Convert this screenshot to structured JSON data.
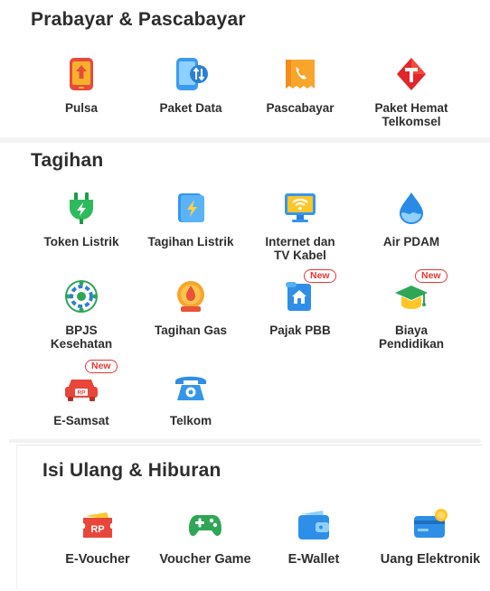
{
  "sections": [
    {
      "title": "Prabayar & Pascabayar",
      "items": [
        {
          "label": "Pulsa",
          "icon": "phone-upload-icon"
        },
        {
          "label": "Paket Data",
          "icon": "phone-data-icon"
        },
        {
          "label": "Pascabayar",
          "icon": "bill-phone-icon"
        },
        {
          "label": "Paket Hemat Telkomsel",
          "icon": "telkomsel-logo-icon"
        }
      ]
    },
    {
      "title": "Tagihan",
      "items": [
        {
          "label": "Token Listrik",
          "icon": "plug-icon"
        },
        {
          "label": "Tagihan Listrik",
          "icon": "electric-bill-icon"
        },
        {
          "label": "Internet dan TV Kabel",
          "icon": "wifi-tv-icon"
        },
        {
          "label": "Air PDAM",
          "icon": "water-drop-icon"
        },
        {
          "label": "BPJS Kesehatan",
          "icon": "bpjs-icon"
        },
        {
          "label": "Tagihan Gas",
          "icon": "gas-icon"
        },
        {
          "label": "Pajak PBB",
          "icon": "property-tax-icon",
          "badge": "New"
        },
        {
          "label": "Biaya Pendidikan",
          "icon": "graduation-cap-icon",
          "badge": "New"
        },
        {
          "label": "E-Samsat",
          "icon": "car-tax-icon",
          "badge": "New"
        },
        {
          "label": "Telkom",
          "icon": "telephone-icon"
        }
      ]
    },
    {
      "title": "Isi Ulang & Hiburan",
      "items": [
        {
          "label": "E-Voucher",
          "icon": "voucher-icon"
        },
        {
          "label": "Voucher Game",
          "icon": "gamepad-icon"
        },
        {
          "label": "E-Wallet",
          "icon": "wallet-icon"
        },
        {
          "label": "Uang Elektronik",
          "icon": "card-icon"
        }
      ]
    }
  ],
  "colors": {
    "orange": "#f28c28",
    "red": "#e53935",
    "blue": "#2f8fe8",
    "green": "#27a844",
    "yellow": "#ffc629"
  }
}
